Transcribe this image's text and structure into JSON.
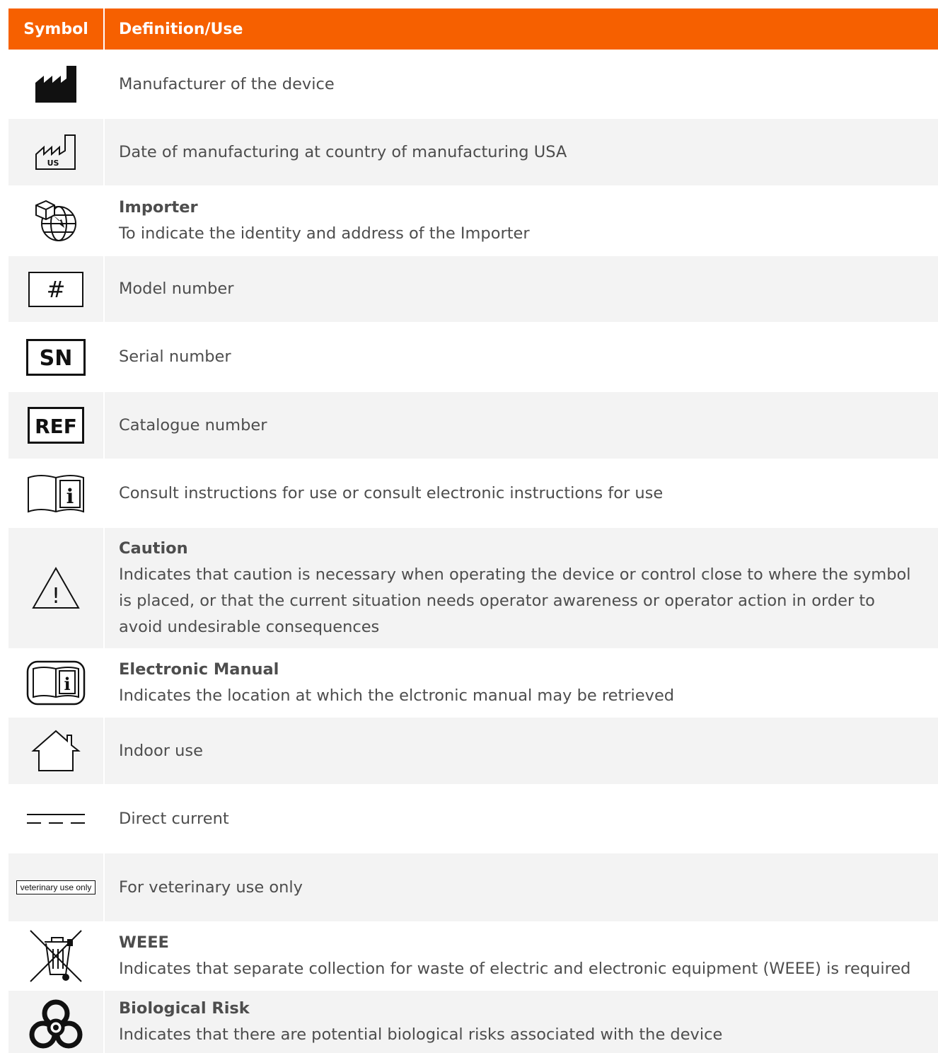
{
  "header": {
    "symbol": "Symbol",
    "definition": "Definition/Use"
  },
  "colors": {
    "accent": "#f66000",
    "row_shade": "#f3f3f3",
    "text": "#4d4d4d"
  },
  "rows": [
    {
      "icon": "manufacturer-icon",
      "title": "",
      "text": "Manufacturer of the device"
    },
    {
      "icon": "date-of-manufacture-icon",
      "icon_text": "US",
      "title": "",
      "text": "Date of manufacturing at country of manufacturing USA"
    },
    {
      "icon": "importer-icon",
      "title": "Importer",
      "text": "To indicate the identity and address of the Importer"
    },
    {
      "icon": "model-number-icon",
      "icon_text": "#",
      "title": "",
      "text": "Model number"
    },
    {
      "icon": "serial-number-icon",
      "icon_text": "SN",
      "title": "",
      "text": "Serial number"
    },
    {
      "icon": "catalogue-number-icon",
      "icon_text": "REF",
      "title": "",
      "text": "Catalogue number"
    },
    {
      "icon": "consult-instructions-icon",
      "icon_text": "i",
      "title": "",
      "text": "Consult instructions for use or consult electronic instructions for use"
    },
    {
      "icon": "caution-icon",
      "icon_text": "!",
      "title": "Caution",
      "text": "Indicates that caution is necessary when operating the device or control close to where the symbol\nis placed, or that the current situation needs operator awareness or operator action in order to\navoid undesirable consequences"
    },
    {
      "icon": "electronic-manual-icon",
      "icon_text": "i",
      "title": "Electronic Manual",
      "text": "Indicates the location at which the elctronic manual may be retrieved"
    },
    {
      "icon": "indoor-use-icon",
      "title": "",
      "text": "Indoor use"
    },
    {
      "icon": "direct-current-icon",
      "title": "",
      "text": "Direct current"
    },
    {
      "icon": "veterinary-use-icon",
      "icon_text": "veterinary use only",
      "title": "",
      "text": "For veterinary use only"
    },
    {
      "icon": "weee-icon",
      "title": "WEEE",
      "text": "Indicates that separate collection for waste of electric and electronic equipment (WEEE) is required"
    },
    {
      "icon": "biohazard-icon",
      "title": "Biological Risk",
      "text": "Indicates that there are potential biological risks associated with the device"
    }
  ]
}
